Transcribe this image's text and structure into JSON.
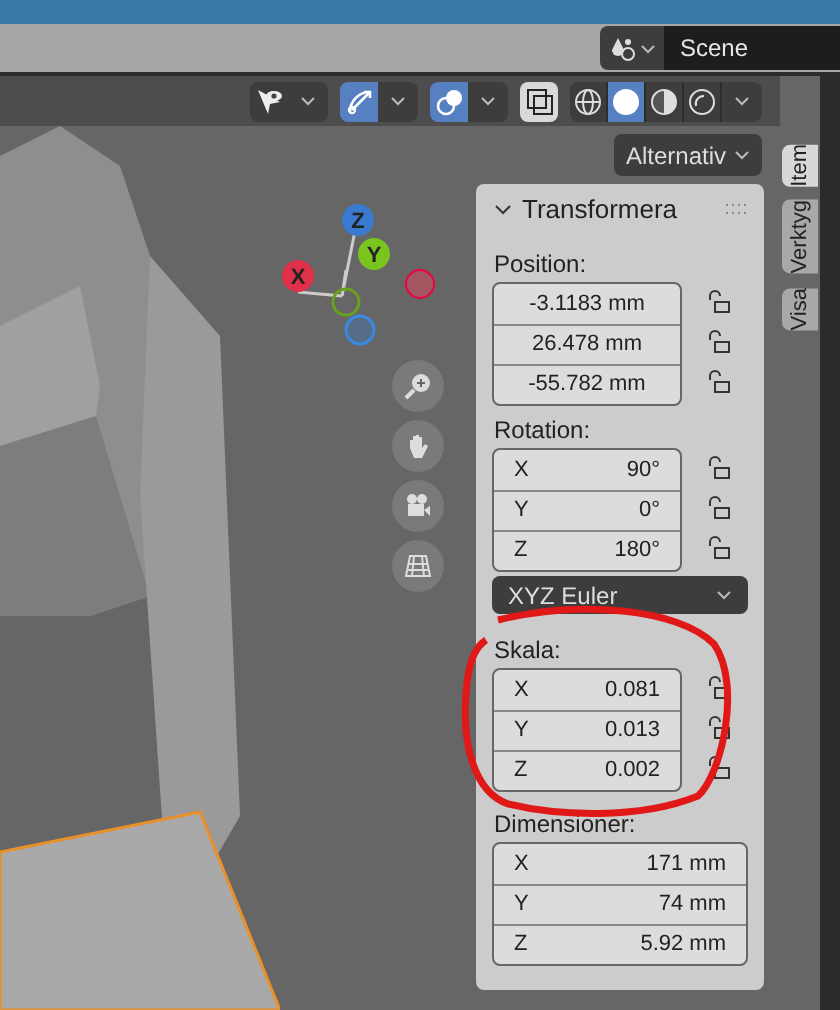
{
  "top_bar": {
    "scene": "Scene"
  },
  "viewport_header": {
    "toggles": [
      {
        "selected": false
      },
      {
        "selected": true
      },
      {
        "selected": true
      },
      {
        "selected": false
      }
    ],
    "shading": [
      {
        "selected": false
      },
      {
        "selected": true
      },
      {
        "selected": false
      },
      {
        "selected": false
      }
    ]
  },
  "options_button": "Alternativ",
  "gizmo": {
    "axes": [
      {
        "label": "Z"
      },
      {
        "label": "Y"
      },
      {
        "label": "X"
      }
    ]
  },
  "panel": {
    "title": "Transformera",
    "expanded": true,
    "position": {
      "label": "Position:",
      "fields": [
        {
          "value": "-3.1183 mm",
          "locked": false
        },
        {
          "value": "26.478 mm",
          "locked": false
        },
        {
          "value": "-55.782 mm",
          "locked": false
        }
      ]
    },
    "rotation": {
      "label": "Rotation:",
      "fields": [
        {
          "axis": "X",
          "value": "90°",
          "locked": false
        },
        {
          "axis": "Y",
          "value": "0°",
          "locked": false
        },
        {
          "axis": "Z",
          "value": "180°",
          "locked": false
        }
      ]
    },
    "rotation_mode": "XYZ Euler",
    "scale": {
      "label": "Skala:",
      "fields": [
        {
          "axis": "X",
          "value": "0.081",
          "locked": false
        },
        {
          "axis": "Y",
          "value": "0.013",
          "locked": false
        },
        {
          "axis": "Z",
          "value": "0.002",
          "locked": false
        }
      ]
    },
    "dimensions": {
      "label": "Dimensioner:",
      "fields": [
        {
          "axis": "X",
          "value": "171 mm"
        },
        {
          "axis": "Y",
          "value": "74 mm"
        },
        {
          "axis": "Z",
          "value": "5.92 mm"
        }
      ]
    }
  },
  "sidebar_tabs": [
    {
      "label": "Item",
      "selected": true
    },
    {
      "label": "Verktyg",
      "selected": false
    },
    {
      "label": "Visa",
      "selected": false
    }
  ]
}
